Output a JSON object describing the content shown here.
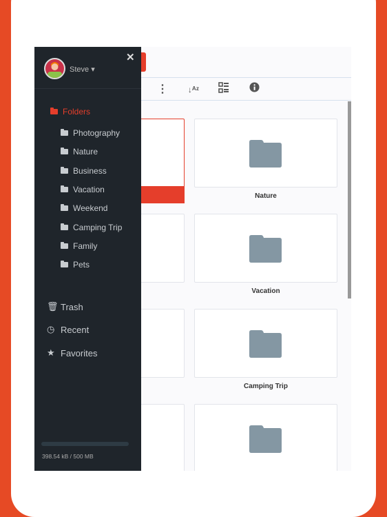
{
  "user": {
    "name": "Steve"
  },
  "sidebar": {
    "folders_label": "Folders",
    "folders": [
      "Photography",
      "Nature",
      "Business",
      "Vacation",
      "Weekend",
      "Camping Trip",
      "Family",
      "Pets"
    ],
    "trash": "Trash",
    "recent": "Recent",
    "favorites": "Favorites",
    "storage": "398.54 kB / 500 MB"
  },
  "grid": {
    "labels": [
      "Nature",
      "Vacation",
      "Camping Trip"
    ]
  },
  "colors": {
    "accent": "#e53e2b",
    "sidebar": "#1f252b",
    "folder": "#8497a3"
  }
}
